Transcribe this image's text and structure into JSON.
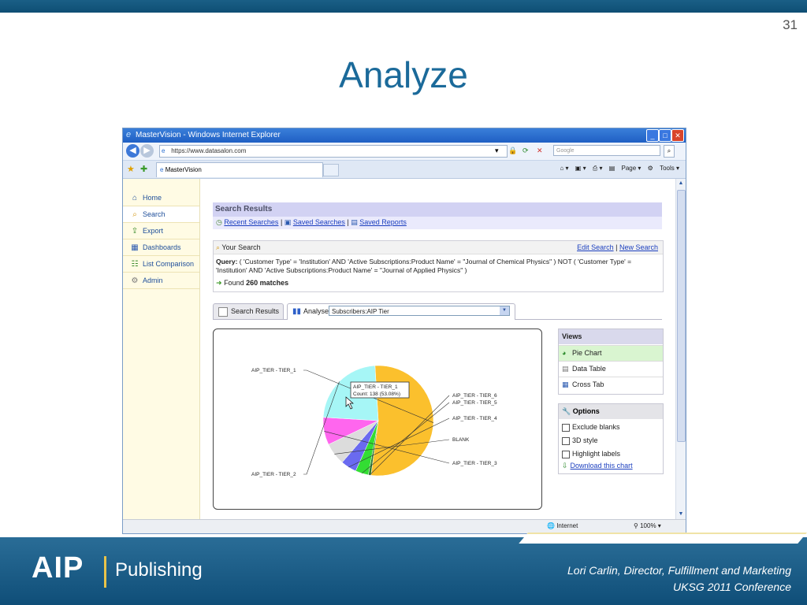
{
  "slide": {
    "page_number": "31",
    "title": "Analyze",
    "footer_line1": "Lori Carlin, Director, Fulfillment and Marketing",
    "footer_line2": "UKSG 2011 Conference",
    "logo_aip": "AIP",
    "logo_publishing": "Publishing"
  },
  "browser": {
    "window_title": "MasterVision - Windows Internet Explorer",
    "url": "https://www.datasalon.com",
    "search_placeholder": "Google",
    "tab_title": "MasterVision",
    "cmd_page": "Page",
    "cmd_tools": "Tools",
    "status_zone": "Internet",
    "status_zoom": "100%"
  },
  "sidebar": {
    "items": [
      {
        "label": "Home",
        "icon": "home-icon"
      },
      {
        "label": "Search",
        "icon": "search-icon"
      },
      {
        "label": "Export",
        "icon": "export-icon"
      },
      {
        "label": "Dashboards",
        "icon": "dashboard-icon"
      },
      {
        "label": "List Comparison",
        "icon": "list-compare-icon"
      },
      {
        "label": "Admin",
        "icon": "gear-icon"
      }
    ]
  },
  "results": {
    "title": "Search Results",
    "recent_searches": "Recent Searches",
    "saved_searches": "Saved Searches",
    "saved_reports": "Saved Reports",
    "separator": "|"
  },
  "your_search": {
    "title": "Your Search",
    "edit_search": "Edit Search",
    "new_search": "New Search",
    "query_label": "Query:",
    "query_text": "( 'Customer Type' = 'Institution' AND 'Active Subscriptions:Product Name' = \"Journal of Chemical Physics\" ) NOT ( 'Customer Type' = 'Institution' AND 'Active Subscriptions:Product Name' = \"Journal of Applied Physics\" )",
    "found_prefix": "Found",
    "found_count": "260 matches"
  },
  "tabs": {
    "search_results": "Search Results",
    "analyse": "Analyse",
    "analyse_selected": "Subscribers:AIP Tier"
  },
  "views": {
    "title": "Views",
    "items": [
      "Pie Chart",
      "Data Table",
      "Cross Tab"
    ]
  },
  "options": {
    "title": "Options",
    "items": [
      "Exclude blanks",
      "3D style",
      "Highlight labels"
    ],
    "download": "Download this chart"
  },
  "chart_data": {
    "type": "pie",
    "slices": [
      {
        "label": "AIP_TIER - TIER_1",
        "value": 138,
        "color": "#fbc02d"
      },
      {
        "label": "AIP_TIER - TIER_6",
        "value": 2,
        "color": "#2e7d32"
      },
      {
        "label": "AIP_TIER - TIER_5",
        "value": 10,
        "color": "#33dd33"
      },
      {
        "label": "AIP_TIER - TIER_4",
        "value": 12,
        "color": "#6a6af0"
      },
      {
        "label": "BLANK",
        "value": 17,
        "color": "#dcdcdc"
      },
      {
        "label": "AIP_TIER - TIER_3",
        "value": 21,
        "color": "#ff66ee"
      },
      {
        "label": "AIP_TIER - TIER_2",
        "value": 60,
        "color": "#a6f6f6"
      }
    ],
    "tooltip": {
      "label": "AIP_TIER - TIER_1",
      "text": "Count: 138 (53.08%)"
    }
  }
}
